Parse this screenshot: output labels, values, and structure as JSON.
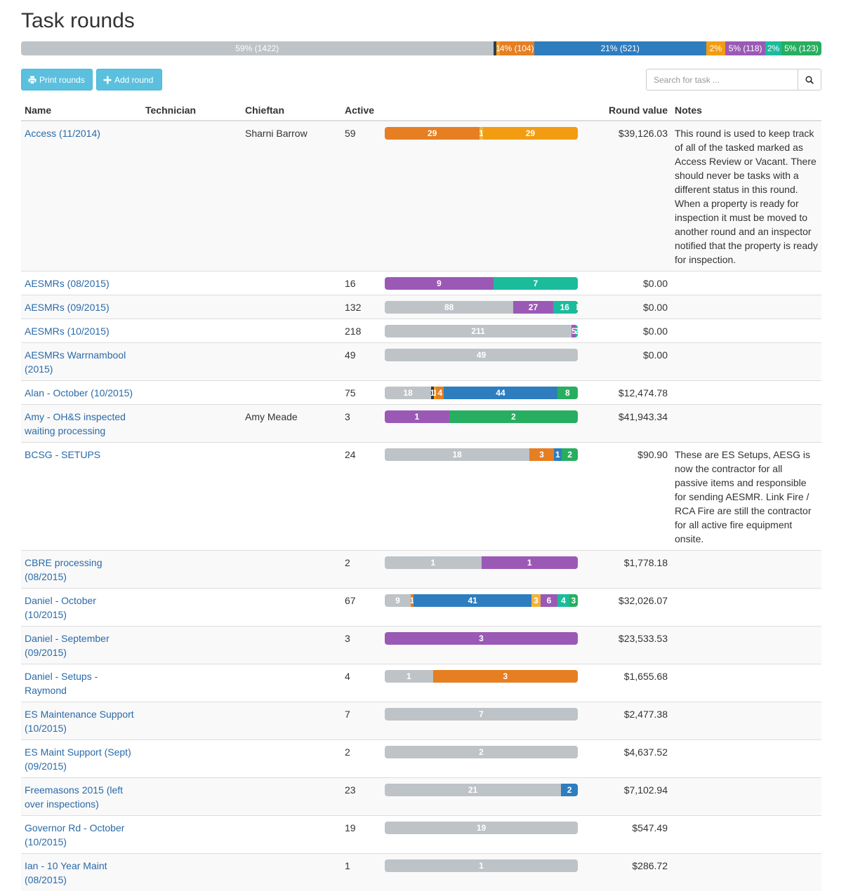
{
  "title": "Task rounds",
  "summary_bar": [
    {
      "label": "59% (1422)",
      "pct": 59,
      "color": "grey"
    },
    {
      "label": "",
      "pct": 0.4,
      "color": "dark"
    },
    {
      "label": "1",
      "pct": 0.4,
      "color": "lorange"
    },
    {
      "label": "4% (104)",
      "pct": 4.3,
      "color": "orange"
    },
    {
      "label": "21% (521)",
      "pct": 21.5,
      "color": "blue"
    },
    {
      "label": "2%",
      "pct": 2.4,
      "color": "lorange"
    },
    {
      "label": "5% (118)",
      "pct": 5,
      "color": "purple"
    },
    {
      "label": "2%",
      "pct": 2,
      "color": "teal"
    },
    {
      "label": "5% (123)",
      "pct": 5,
      "color": "green"
    }
  ],
  "toolbar": {
    "print_label": "Print rounds",
    "add_label": "Add round",
    "search_placeholder": "Search for task ..."
  },
  "columns": {
    "name": "Name",
    "technician": "Technician",
    "chieftan": "Chieftan",
    "active": "Active",
    "progress": "",
    "value": "Round value",
    "notes": "Notes"
  },
  "rows": [
    {
      "name": "Access (11/2014)",
      "technician": "",
      "chieftan": "Sharni Barrow",
      "active": "59",
      "value": "$39,126.03",
      "notes": "This round is used to keep track of all of the tasked marked as Access Review or Vacant. There should never be tasks with a different status in this round. When a property is ready for inspection it must be moved to another round and an inspector notified that the property is ready for inspection.",
      "segments": [
        {
          "label": "29",
          "value": 29,
          "color": "orange"
        },
        {
          "label": "1",
          "value": 1,
          "color": "yellow"
        },
        {
          "label": "29",
          "value": 29,
          "color": "lorange"
        }
      ]
    },
    {
      "name": "AESMRs (08/2015)",
      "technician": "",
      "chieftan": "",
      "active": "16",
      "value": "$0.00",
      "notes": "",
      "segments": [
        {
          "label": "9",
          "value": 9,
          "color": "purple"
        },
        {
          "label": "7",
          "value": 7,
          "color": "teal"
        }
      ]
    },
    {
      "name": "AESMRs (09/2015)",
      "technician": "",
      "chieftan": "",
      "active": "132",
      "value": "$0.00",
      "notes": "",
      "segments": [
        {
          "label": "88",
          "value": 88,
          "color": "grey"
        },
        {
          "label": "27",
          "value": 27,
          "color": "purple"
        },
        {
          "label": "16",
          "value": 16,
          "color": "teal"
        },
        {
          "label": "1",
          "value": 1,
          "color": "green"
        }
      ]
    },
    {
      "name": "AESMRs (10/2015)",
      "technician": "",
      "chieftan": "",
      "active": "218",
      "value": "$0.00",
      "notes": "",
      "segments": [
        {
          "label": "211",
          "value": 211,
          "color": "grey"
        },
        {
          "label": "5",
          "value": 5,
          "color": "purple"
        },
        {
          "label": "2",
          "value": 2,
          "color": "teal"
        }
      ]
    },
    {
      "name": "AESMRs Warrnambool (2015)",
      "technician": "",
      "chieftan": "",
      "active": "49",
      "value": "$0.00",
      "notes": "",
      "segments": [
        {
          "label": "49",
          "value": 49,
          "color": "grey"
        }
      ]
    },
    {
      "name": "Alan - October (10/2015)",
      "technician": "",
      "chieftan": "",
      "active": "75",
      "value": "$12,474.78",
      "notes": "",
      "segments": [
        {
          "label": "18",
          "value": 18,
          "color": "grey"
        },
        {
          "label": "1",
          "value": 1,
          "color": "dark"
        },
        {
          "label": "1",
          "value": 1,
          "color": "lorange"
        },
        {
          "label": "4",
          "value": 3,
          "color": "orange"
        },
        {
          "label": "44",
          "value": 44,
          "color": "blue"
        },
        {
          "label": "8",
          "value": 8,
          "color": "green"
        }
      ]
    },
    {
      "name": "Amy - OH&S inspected waiting processing",
      "technician": "",
      "chieftan": "Amy Meade",
      "active": "3",
      "value": "$41,943.34",
      "notes": "",
      "segments": [
        {
          "label": "1",
          "value": 1,
          "color": "purple"
        },
        {
          "label": "2",
          "value": 2,
          "color": "green"
        }
      ]
    },
    {
      "name": "BCSG - SETUPS",
      "technician": "",
      "chieftan": "",
      "active": "24",
      "value": "$90.90",
      "notes": "These are ES Setups, AESG is now the contractor for all passive items and responsible for sending AESMR. Link Fire / RCA Fire are still the contractor for all active fire equipment onsite.",
      "segments": [
        {
          "label": "18",
          "value": 18,
          "color": "grey"
        },
        {
          "label": "3",
          "value": 3,
          "color": "orange"
        },
        {
          "label": "1",
          "value": 1,
          "color": "blue"
        },
        {
          "label": "2",
          "value": 2,
          "color": "green"
        }
      ]
    },
    {
      "name": "CBRE processing (08/2015)",
      "technician": "",
      "chieftan": "",
      "active": "2",
      "value": "$1,778.18",
      "notes": "",
      "segments": [
        {
          "label": "1",
          "value": 1,
          "color": "grey"
        },
        {
          "label": "1",
          "value": 1,
          "color": "purple"
        }
      ]
    },
    {
      "name": "Daniel - October (10/2015)",
      "technician": "",
      "chieftan": "",
      "active": "67",
      "value": "$32,026.07",
      "notes": "",
      "segments": [
        {
          "label": "9",
          "value": 9,
          "color": "grey"
        },
        {
          "label": "1",
          "value": 1,
          "color": "orange"
        },
        {
          "label": "41",
          "value": 41,
          "color": "blue"
        },
        {
          "label": "3",
          "value": 3,
          "color": "yellow"
        },
        {
          "label": "6",
          "value": 6,
          "color": "purple"
        },
        {
          "label": "4",
          "value": 4,
          "color": "teal"
        },
        {
          "label": "3",
          "value": 3,
          "color": "green"
        }
      ]
    },
    {
      "name": "Daniel - September (09/2015)",
      "technician": "",
      "chieftan": "",
      "active": "3",
      "value": "$23,533.53",
      "notes": "",
      "segments": [
        {
          "label": "3",
          "value": 3,
          "color": "purple"
        }
      ]
    },
    {
      "name": "Daniel - Setups - Raymond",
      "technician": "",
      "chieftan": "",
      "active": "4",
      "value": "$1,655.68",
      "notes": "",
      "segments": [
        {
          "label": "1",
          "value": 1,
          "color": "grey"
        },
        {
          "label": "3",
          "value": 3,
          "color": "orange"
        }
      ]
    },
    {
      "name": "ES Maintenance Support (10/2015)",
      "technician": "",
      "chieftan": "",
      "active": "7",
      "value": "$2,477.38",
      "notes": "",
      "segments": [
        {
          "label": "7",
          "value": 7,
          "color": "grey"
        }
      ]
    },
    {
      "name": "ES Maint Support (Sept) (09/2015)",
      "technician": "",
      "chieftan": "",
      "active": "2",
      "value": "$4,637.52",
      "notes": "",
      "segments": [
        {
          "label": "2",
          "value": 2,
          "color": "grey"
        }
      ]
    },
    {
      "name": "Freemasons 2015 (left over inspections)",
      "technician": "",
      "chieftan": "",
      "active": "23",
      "value": "$7,102.94",
      "notes": "",
      "segments": [
        {
          "label": "21",
          "value": 21,
          "color": "grey"
        },
        {
          "label": "2",
          "value": 2,
          "color": "blue"
        }
      ]
    },
    {
      "name": "Governor Rd - October (10/2015)",
      "technician": "",
      "chieftan": "",
      "active": "19",
      "value": "$547.49",
      "notes": "",
      "segments": [
        {
          "label": "19",
          "value": 19,
          "color": "grey"
        }
      ]
    },
    {
      "name": "Ian - 10 Year Maint (08/2015)",
      "technician": "",
      "chieftan": "",
      "active": "1",
      "value": "$286.72",
      "notes": "",
      "segments": [
        {
          "label": "1",
          "value": 1,
          "color": "grey"
        }
      ]
    }
  ]
}
